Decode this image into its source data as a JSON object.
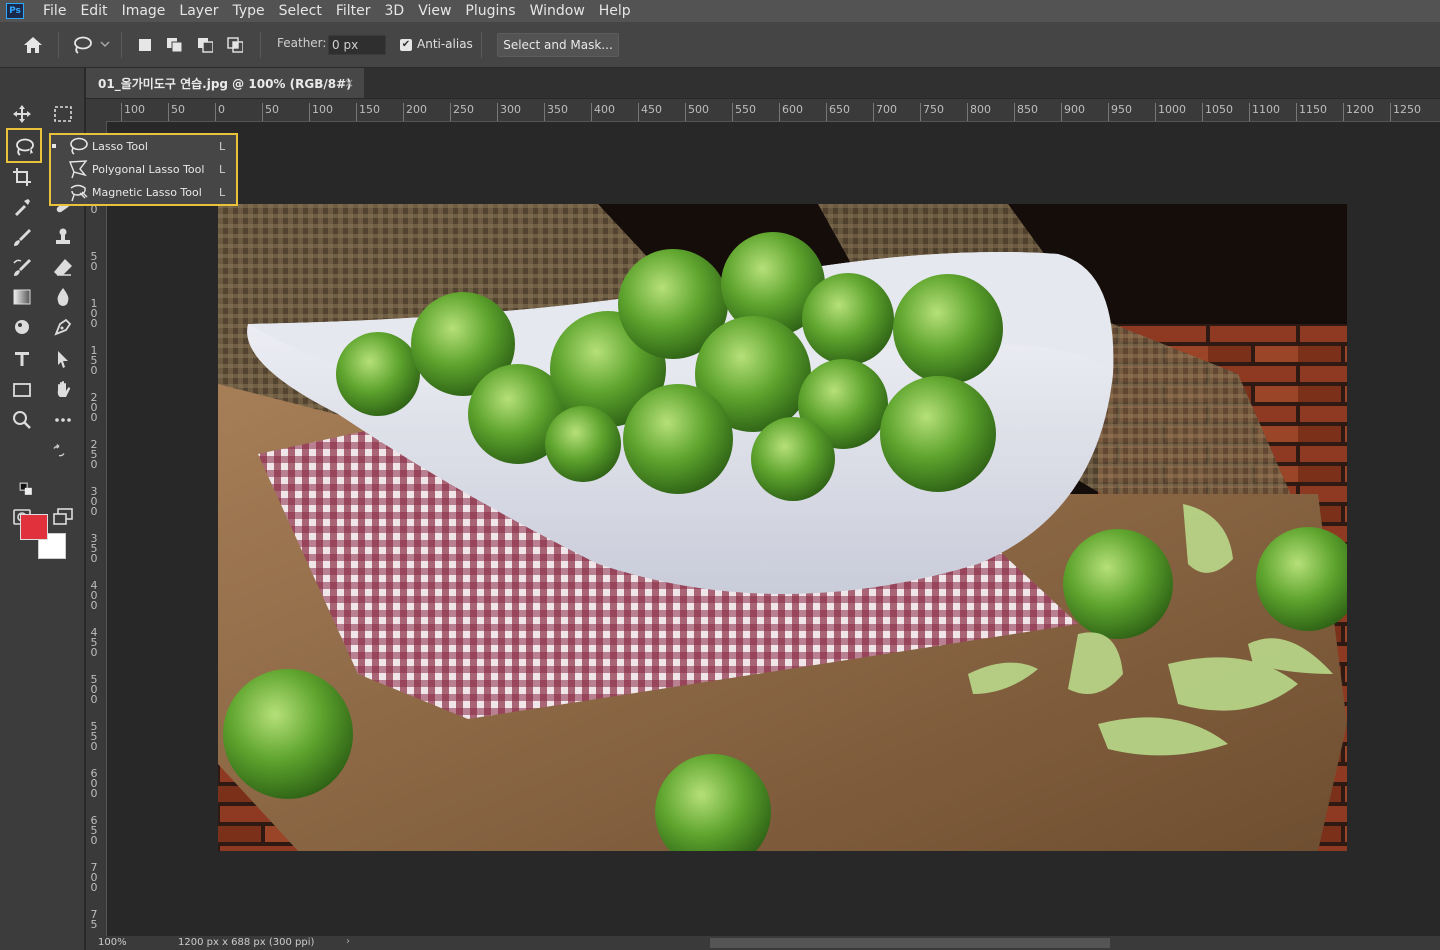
{
  "app": {
    "logo": "Ps"
  },
  "menu": [
    "File",
    "Edit",
    "Image",
    "Layer",
    "Type",
    "Select",
    "Filter",
    "3D",
    "View",
    "Plugins",
    "Window",
    "Help"
  ],
  "options": {
    "feather_label": "Feather:",
    "feather_value": "0 px",
    "anti_alias_label": "Anti-alias",
    "anti_alias_checked": true,
    "select_mask_label": "Select and Mask..."
  },
  "document": {
    "tab_title": "01_올가미도구 연습.jpg @ 100% (RGB/8#)",
    "close": "×"
  },
  "ruler": {
    "h_labels": [
      "100",
      "50",
      "0",
      "50",
      "100",
      "150",
      "200",
      "250",
      "300",
      "350",
      "400",
      "450",
      "500",
      "550",
      "600",
      "650",
      "700",
      "750",
      "800",
      "850",
      "900",
      "950",
      "1000",
      "1050",
      "1100",
      "1150",
      "1200",
      "1250"
    ],
    "v_labels": [
      "0",
      "5 0",
      "1 0 0",
      "1 5 0",
      "2 0 0",
      "2 5 0",
      "3 0 0",
      "3 5 0",
      "4 0 0",
      "4 5 0",
      "5 0 0",
      "5 5 0",
      "6 0 0",
      "6 5 0",
      "7 0 0",
      "7 5"
    ]
  },
  "flyout": [
    {
      "label": "Lasso Tool",
      "key": "L",
      "active": true,
      "icon": "lasso-icon"
    },
    {
      "label": "Polygonal Lasso Tool",
      "key": "L",
      "active": false,
      "icon": "polygonal-lasso-icon"
    },
    {
      "label": "Magnetic Lasso Tool",
      "key": "L",
      "active": false,
      "icon": "magnetic-lasso-icon"
    }
  ],
  "colors": {
    "foreground": "#e1313c",
    "background": "#ffffff",
    "highlight": "#e8c33a"
  },
  "status": {
    "zoom": "100%",
    "info": "1200 px x 688 px (300 ppi)",
    "arrow": "›"
  }
}
